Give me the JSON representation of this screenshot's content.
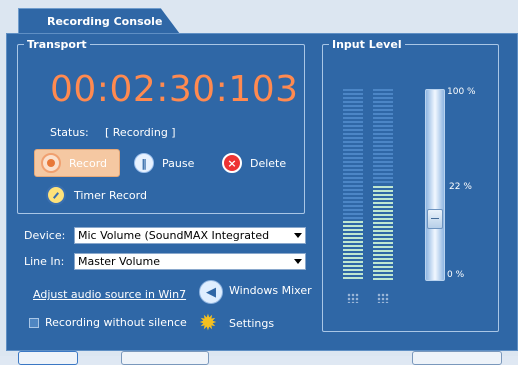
{
  "tab": {
    "label": "Recording Console"
  },
  "transport": {
    "legend": "Transport",
    "timer": "00:02:30:103",
    "status_label": "Status:",
    "status_value": "[ Recording ]",
    "buttons": {
      "record": "Record",
      "pause": "Pause",
      "delete": "Delete",
      "timer_record": "Timer Record"
    }
  },
  "device": {
    "label": "Device:",
    "selected": "Mic Volume (SoundMAX Integrated"
  },
  "line_in": {
    "label": "Line In:",
    "selected": "Master Volume"
  },
  "links": {
    "adjust_audio": "Adjust audio source in Win7",
    "windows_mixer": "Windows Mixer",
    "settings": "Settings"
  },
  "options": {
    "recording_without_silence": "Recording without silence"
  },
  "input_level": {
    "legend": "Input Level",
    "left_channel_level": 0.32,
    "right_channel_level": 0.5,
    "slider_level": 0.3,
    "ticks": [
      "100 %",
      "22 %",
      "0 %"
    ]
  },
  "colors": {
    "panel_bg": "#2f67a6",
    "timer": "#ff8a50",
    "record_active": "#f5c8a2",
    "meter_fill": "#bfe7d0"
  },
  "icons": {
    "record": "record-icon",
    "pause": "pause-icon",
    "delete": "delete-icon",
    "timer": "timer-icon",
    "mixer": "speaker-icon",
    "settings": "gear-icon"
  }
}
